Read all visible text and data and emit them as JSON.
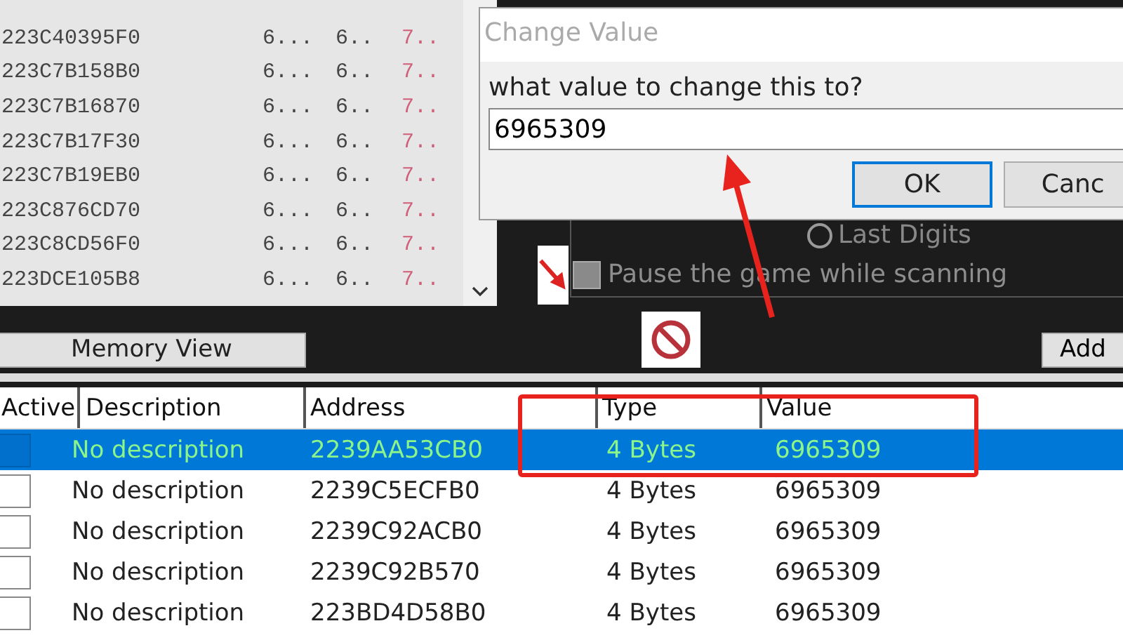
{
  "scan_results": {
    "rows": [
      {
        "address": "223C40395F0",
        "column_2": "6...",
        "column_3": "6..",
        "column_4": "7.."
      },
      {
        "address": "223C7B158B0",
        "column_2": "6...",
        "column_3": "6..",
        "column_4": "7.."
      },
      {
        "address": "223C7B16870",
        "column_2": "6...",
        "column_3": "6..",
        "column_4": "7.."
      },
      {
        "address": "223C7B17F30",
        "column_2": "6...",
        "column_3": "6..",
        "column_4": "7.."
      },
      {
        "address": "223C7B19EB0",
        "column_2": "6...",
        "column_3": "6..",
        "column_4": "7.."
      },
      {
        "address": "223C876CD70",
        "column_2": "6...",
        "column_3": "6..",
        "column_4": "7.."
      },
      {
        "address": "223C8CD56F0",
        "column_2": "6...",
        "column_3": "6..",
        "column_4": "7.."
      },
      {
        "address": "223DCE105B8",
        "column_2": "6...",
        "column_3": "6..",
        "column_4": "7.."
      }
    ]
  },
  "scan_options": {
    "last_digits": {
      "label": "Last Digits",
      "selected": false
    },
    "pause": {
      "label": "Pause the game while scanning",
      "checked": false
    }
  },
  "dialog": {
    "title": "Change Value",
    "prompt": "what value to change this to?",
    "value": "6965309",
    "buttons": [
      {
        "label": "OK",
        "default": true
      },
      {
        "label": "Canc",
        "default": false
      }
    ]
  },
  "toolbar": {
    "memory_view": "Memory View",
    "add": "Add"
  },
  "table": {
    "columns": [
      "Active",
      "Description",
      "Address",
      "Type",
      "Value"
    ],
    "rows": [
      {
        "active": false,
        "selected": true,
        "description": "No description",
        "address": "2239AA53CB0",
        "type": "4 Bytes",
        "value": "6965309"
      },
      {
        "active": false,
        "selected": false,
        "description": "No description",
        "address": "2239C5ECFB0",
        "type": "4 Bytes",
        "value": "6965309"
      },
      {
        "active": false,
        "selected": false,
        "description": "No description",
        "address": "2239C92ACB0",
        "type": "4 Bytes",
        "value": "6965309"
      },
      {
        "active": false,
        "selected": false,
        "description": "No description",
        "address": "2239C92B570",
        "type": "4 Bytes",
        "value": "6965309"
      },
      {
        "active": false,
        "selected": false,
        "description": "No description",
        "address": "223BD4D58B0",
        "type": "4 Bytes",
        "value": "6965309"
      }
    ]
  }
}
